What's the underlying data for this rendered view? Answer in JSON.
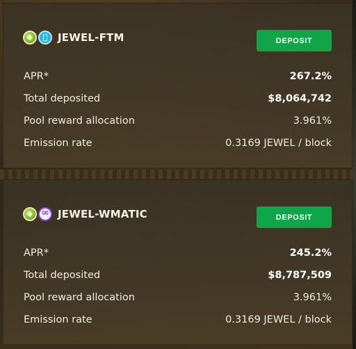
{
  "pools": [
    {
      "name": "JEWEL-FTM",
      "tokens": [
        "jewel-icon",
        "ftm-icon"
      ],
      "deposit_label": "DEPOSIT",
      "stats": [
        {
          "label": "APR*",
          "value": "267.2%"
        },
        {
          "label": "Total deposited",
          "value": "$8,064,742"
        },
        {
          "label": "Pool reward allocation",
          "value": "3.961%"
        },
        {
          "label": "Emission rate",
          "value": "0.3169 JEWEL / block"
        }
      ]
    },
    {
      "name": "JEWEL-WMATIC",
      "tokens": [
        "jewel-icon",
        "matic-icon"
      ],
      "deposit_label": "DEPOSIT",
      "stats": [
        {
          "label": "APR*",
          "value": "245.2%"
        },
        {
          "label": "Total deposited",
          "value": "$8,787,509"
        },
        {
          "label": "Pool reward allocation",
          "value": "3.961%"
        },
        {
          "label": "Emission rate",
          "value": "0.3169 JEWEL / block"
        }
      ]
    }
  ],
  "colors": {
    "button": "#0fa64a",
    "card": "#3a3224",
    "text": "#f0ece3"
  }
}
